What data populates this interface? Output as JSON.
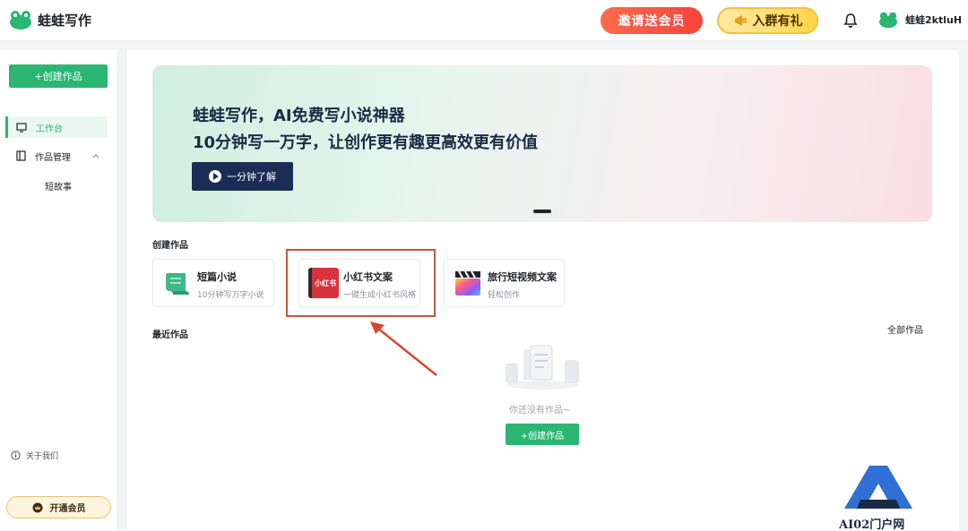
{
  "header": {
    "app_name": "蛙蛙写作",
    "invite_label": "邀请送会员",
    "group_label": "入群有礼",
    "user_name": "蛙蛙2ktluH"
  },
  "sidebar": {
    "create_label": "+创建作品",
    "items": [
      {
        "label": "工作台",
        "icon": "monitor-icon",
        "active": true
      },
      {
        "label": "作品管理",
        "icon": "book-icon",
        "active": false
      }
    ],
    "sub_items": [
      {
        "label": "短故事"
      }
    ],
    "about_label": "关于我们",
    "vip_label": "开通会员"
  },
  "banner": {
    "line1": "蛙蛙写作，AI免费写小说神器",
    "line2": "10分钟写一万字，让创作更有趣更高效更有价值",
    "button_label": "一分钟了解"
  },
  "create_section": {
    "title": "创建作品",
    "cards": [
      {
        "title": "短篇小说",
        "desc": "10分钟写万字小说",
        "icon": "scroll-icon"
      },
      {
        "title": "小红书文案",
        "desc": "一键生成小红书风格",
        "icon": "xiaohongshu-icon",
        "icon_text": "小红书"
      },
      {
        "title": "旅行短视频文案",
        "desc": "轻松创作",
        "icon": "clapperboard-icon"
      }
    ]
  },
  "recent_section": {
    "title": "最近作品",
    "all_label": "全部作品",
    "empty_text": "你还没有作品~",
    "empty_button": "+创建作品"
  },
  "watermark": {
    "text": "AI02门户网"
  },
  "colors": {
    "accent": "#2bb673",
    "banner_button": "#1b2d55",
    "highlight": "#c8553d"
  }
}
